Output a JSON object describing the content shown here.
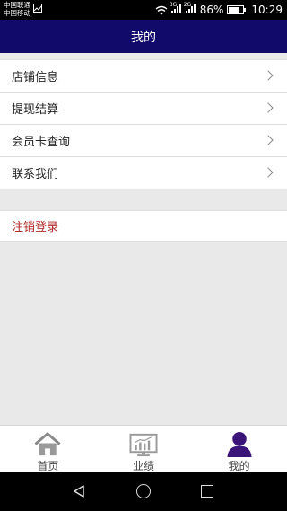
{
  "status_bar": {
    "carrier_1": "中国联通",
    "carrier_2": "中国移动",
    "net_1": "3G",
    "net_2": "2G",
    "battery": "86%",
    "time": "10:29"
  },
  "header": {
    "title": "我的"
  },
  "menu": {
    "items": [
      {
        "label": "店铺信息"
      },
      {
        "label": "提现结算"
      },
      {
        "label": "会员卡查询"
      },
      {
        "label": "联系我们"
      }
    ]
  },
  "logout": {
    "label": "注销登录",
    "color": "#b22a2a"
  },
  "bottom_nav": {
    "items": [
      {
        "label": "首页",
        "icon": "home-icon"
      },
      {
        "label": "业绩",
        "icon": "chart-icon"
      },
      {
        "label": "我的",
        "icon": "user-icon",
        "active": true
      }
    ]
  },
  "colors": {
    "header_bg": "#120a6b",
    "active_icon": "#3a1478"
  }
}
